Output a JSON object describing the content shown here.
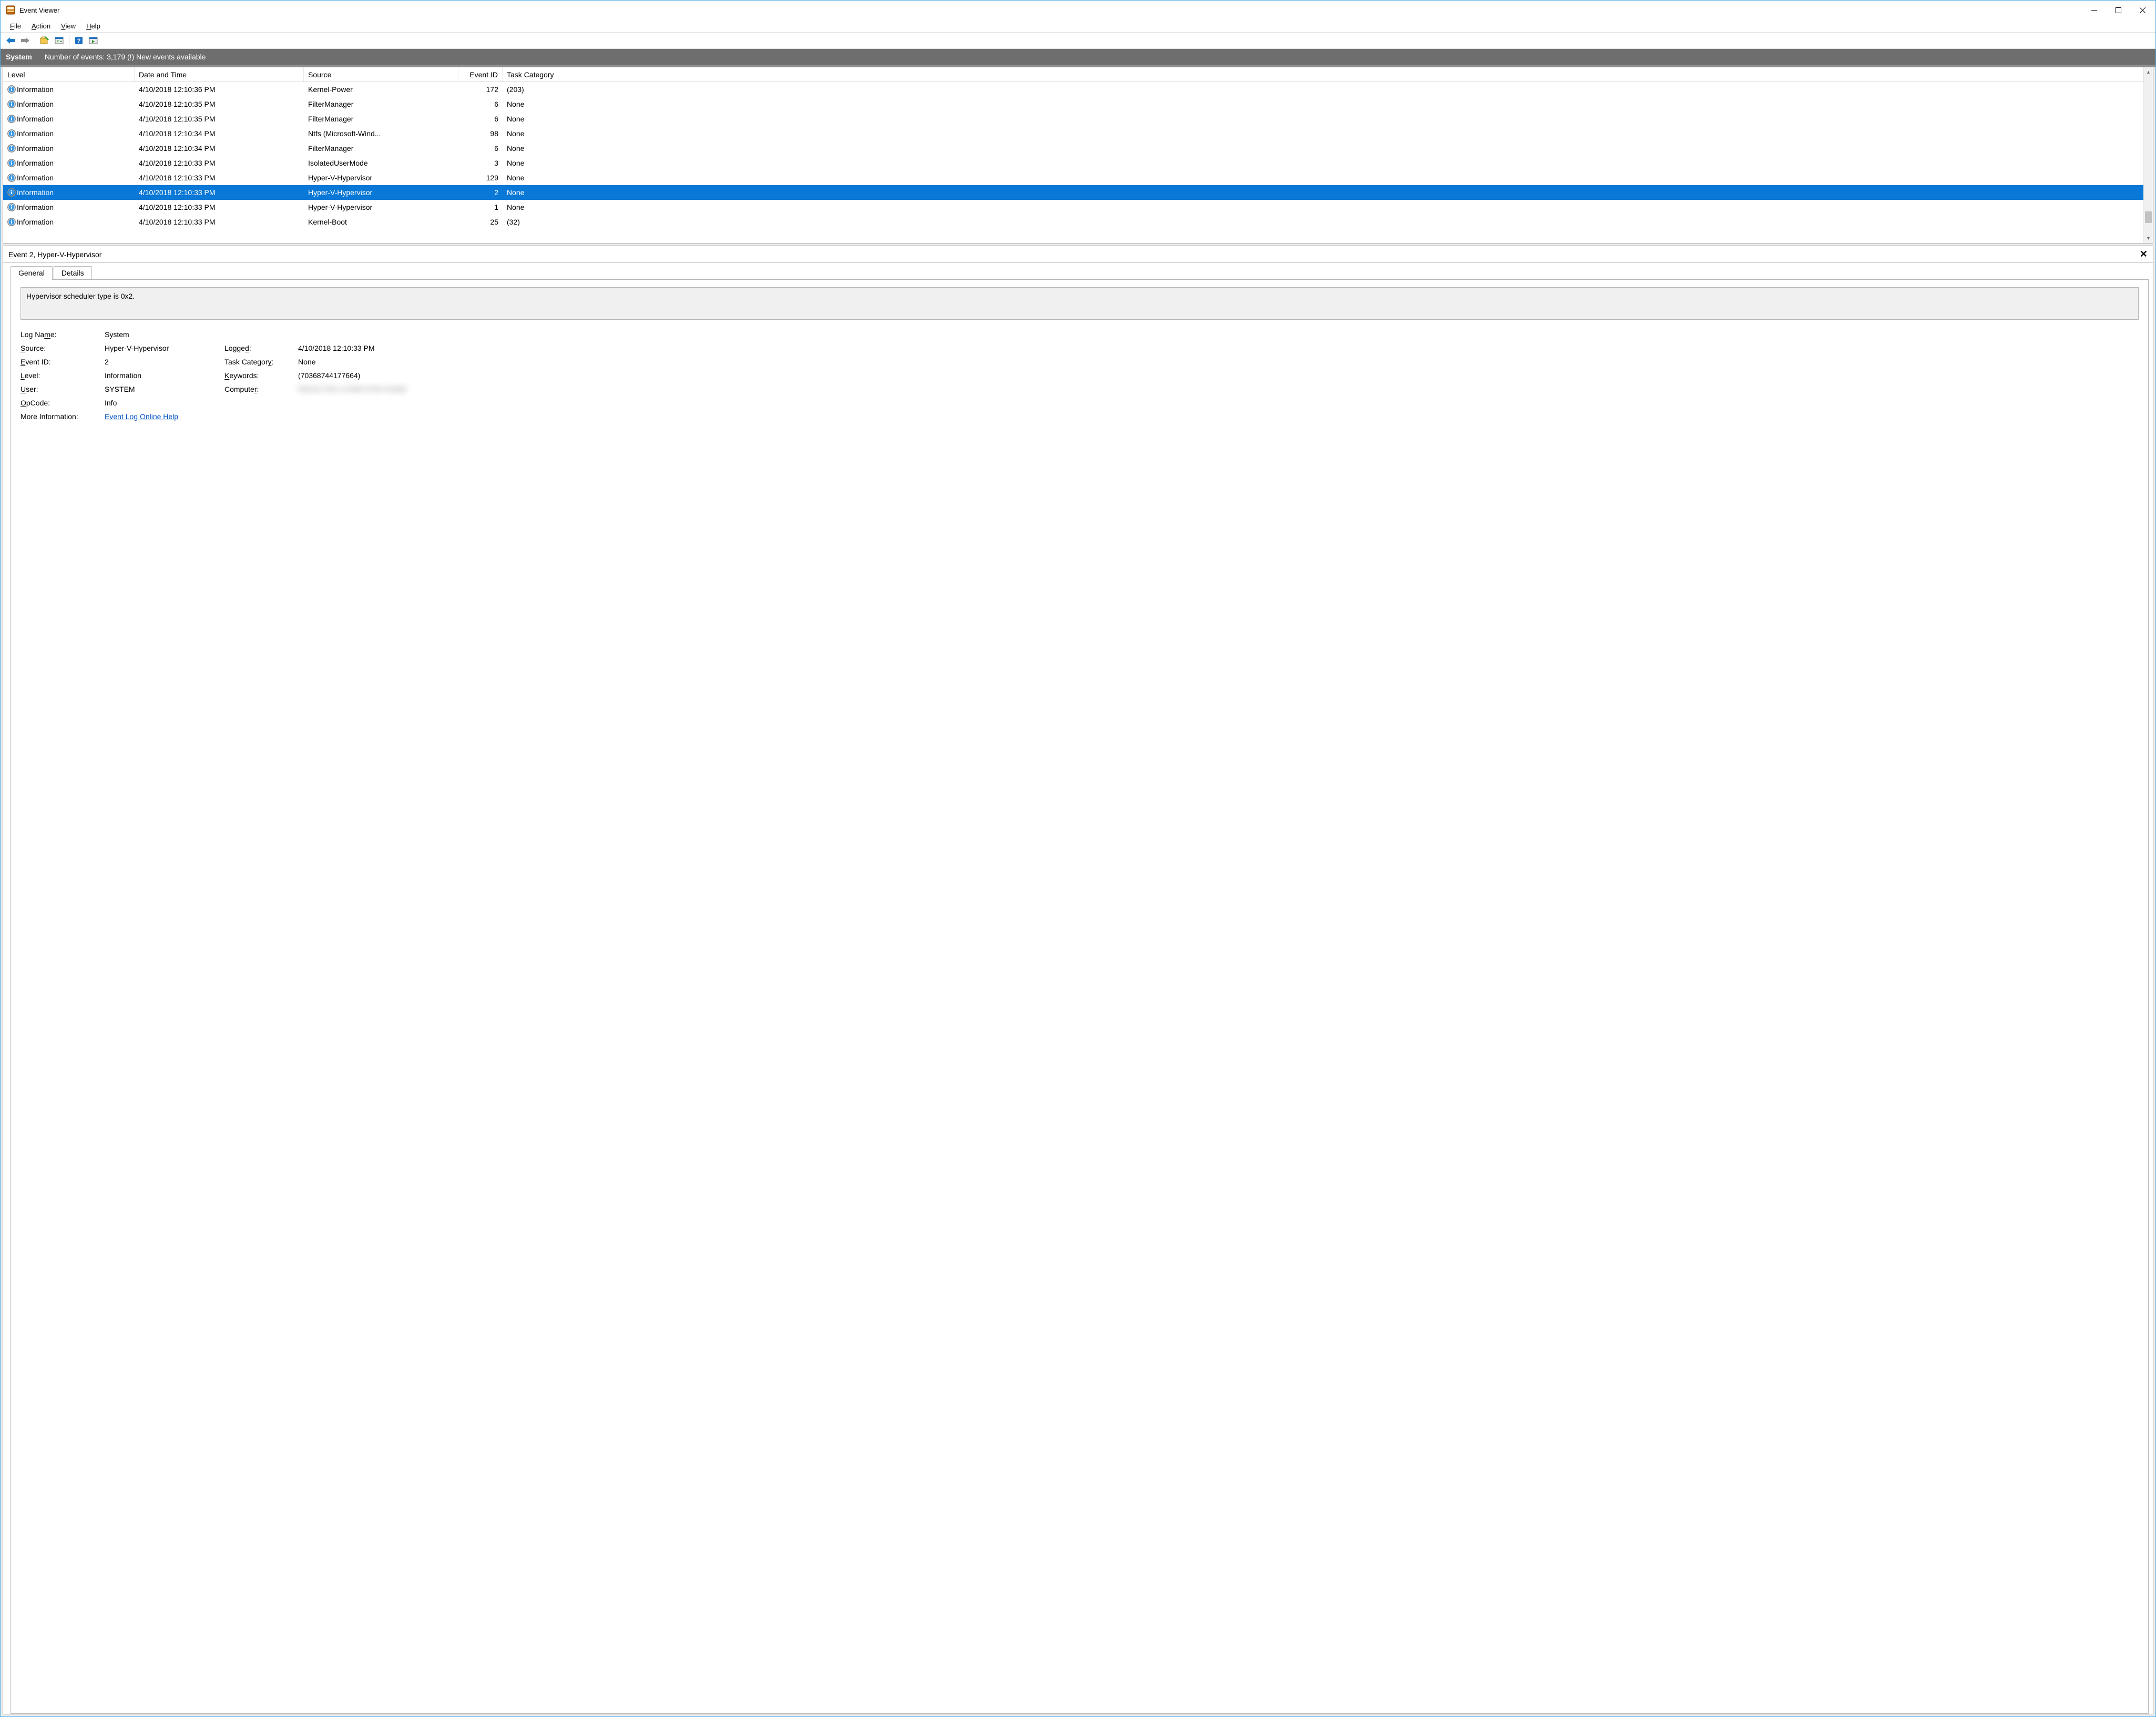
{
  "app_title": "Event Viewer",
  "menu": {
    "file": "File",
    "action": "Action",
    "view": "View",
    "help": "Help"
  },
  "log_header": {
    "name": "System",
    "count_text": "Number of events: 3,179 (!) New events available"
  },
  "columns": {
    "level": "Level",
    "date": "Date and Time",
    "source": "Source",
    "id": "Event ID",
    "task": "Task Category"
  },
  "rows": [
    {
      "level": "Information",
      "date": "4/10/2018 12:10:36 PM",
      "source": "Kernel-Power",
      "id": "172",
      "task": "(203)",
      "selected": false
    },
    {
      "level": "Information",
      "date": "4/10/2018 12:10:35 PM",
      "source": "FilterManager",
      "id": "6",
      "task": "None",
      "selected": false
    },
    {
      "level": "Information",
      "date": "4/10/2018 12:10:35 PM",
      "source": "FilterManager",
      "id": "6",
      "task": "None",
      "selected": false
    },
    {
      "level": "Information",
      "date": "4/10/2018 12:10:34 PM",
      "source": "Ntfs (Microsoft-Wind...",
      "id": "98",
      "task": "None",
      "selected": false
    },
    {
      "level": "Information",
      "date": "4/10/2018 12:10:34 PM",
      "source": "FilterManager",
      "id": "6",
      "task": "None",
      "selected": false
    },
    {
      "level": "Information",
      "date": "4/10/2018 12:10:33 PM",
      "source": "IsolatedUserMode",
      "id": "3",
      "task": "None",
      "selected": false
    },
    {
      "level": "Information",
      "date": "4/10/2018 12:10:33 PM",
      "source": "Hyper-V-Hypervisor",
      "id": "129",
      "task": "None",
      "selected": false
    },
    {
      "level": "Information",
      "date": "4/10/2018 12:10:33 PM",
      "source": "Hyper-V-Hypervisor",
      "id": "2",
      "task": "None",
      "selected": true
    },
    {
      "level": "Information",
      "date": "4/10/2018 12:10:33 PM",
      "source": "Hyper-V-Hypervisor",
      "id": "1",
      "task": "None",
      "selected": false
    },
    {
      "level": "Information",
      "date": "4/10/2018 12:10:33 PM",
      "source": "Kernel-Boot",
      "id": "25",
      "task": "(32)",
      "selected": false
    }
  ],
  "detail": {
    "title": "Event 2, Hyper-V-Hypervisor",
    "tab_general": "General",
    "tab_details": "Details",
    "message": "Hypervisor scheduler type is 0x2.",
    "labels": {
      "log_name": "Log Name:",
      "source": "Source:",
      "event_id": "Event ID:",
      "level": "Level:",
      "user": "User:",
      "opcode": "OpCode:",
      "more_info": "More Information:",
      "logged": "Logged:",
      "task": "Task Category:",
      "keywords": "Keywords:",
      "computer": "Computer:"
    },
    "values": {
      "log_name": "System",
      "source": "Hyper-V-Hypervisor",
      "event_id": "2",
      "level": "Information",
      "user": "SYSTEM",
      "opcode": "Info",
      "logged": "4/10/2018 12:10:33 PM",
      "task": "None",
      "keywords": "(70368744177664)",
      "computer": "REDACTED-COMPUTER-NAME"
    },
    "link": "Event Log Online Help"
  }
}
